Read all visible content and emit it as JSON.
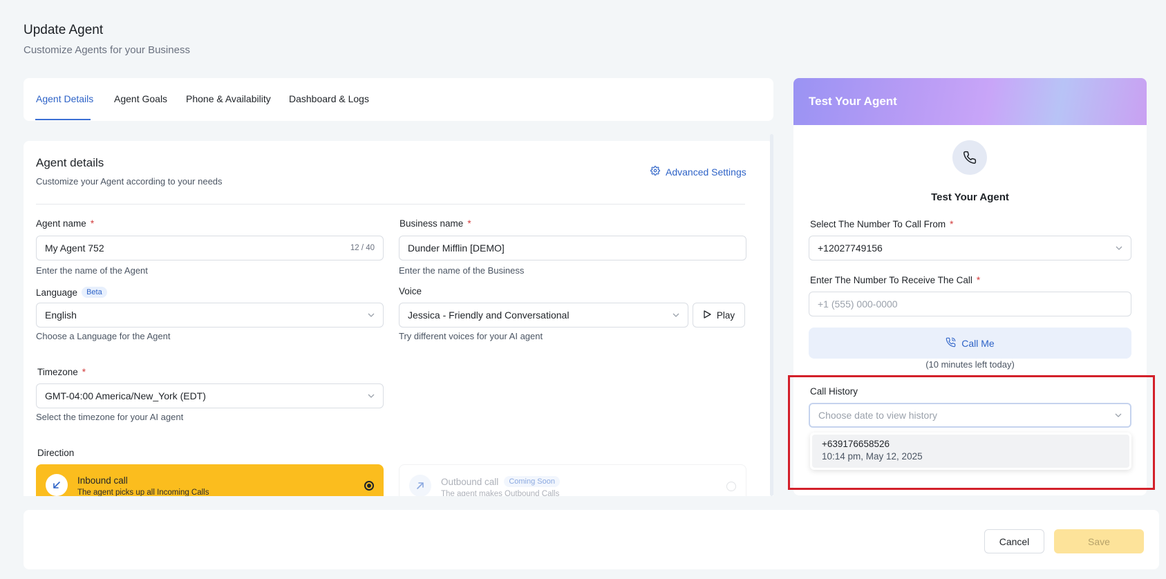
{
  "page": {
    "title": "Update Agent",
    "subtitle": "Customize Agents for your Business"
  },
  "tabs": [
    {
      "label": "Agent Details",
      "active": true
    },
    {
      "label": "Agent Goals",
      "active": false
    },
    {
      "label": "Phone & Availability",
      "active": false
    },
    {
      "label": "Dashboard & Logs",
      "active": false
    }
  ],
  "agent_details": {
    "title": "Agent details",
    "subtitle": "Customize your Agent according to your needs",
    "advanced_settings": "Advanced Settings",
    "agent_name": {
      "label": "Agent name",
      "value": "My Agent 752",
      "counter": "12 / 40",
      "hint": "Enter the name of the Agent"
    },
    "business_name": {
      "label": "Business name",
      "value": "Dunder Mifflin [DEMO]",
      "hint": "Enter the name of the Business"
    },
    "language": {
      "label": "Language",
      "badge": "Beta",
      "value": "English",
      "hint": "Choose a Language for the Agent"
    },
    "voice": {
      "label": "Voice",
      "value": "Jessica - Friendly and Conversational",
      "play": "Play",
      "hint": "Try different voices for your AI agent"
    },
    "timezone": {
      "label": "Timezone",
      "value": "GMT-04:00 America/New_York (EDT)",
      "hint": "Select the timezone for your AI agent"
    },
    "direction": {
      "label": "Direction",
      "inbound": {
        "title": "Inbound call",
        "sub": "The agent picks up all Incoming Calls"
      },
      "outbound": {
        "title": "Outbound call",
        "badge": "Coming Soon",
        "sub": "The agent makes Outbound Calls"
      }
    },
    "required_mark": "*"
  },
  "test_agent": {
    "header": "Test Your Agent",
    "center_title": "Test Your Agent",
    "from_label": "Select The Number To Call From",
    "from_value": "+12027749156",
    "receive_label": "Enter The Number To Receive The Call",
    "receive_placeholder": "+1 (555) 000-0000",
    "call_me": "Call Me",
    "minutes_left": "(10 minutes left today)",
    "history_label": "Call History",
    "history_placeholder": "Choose date to view history",
    "history_items": [
      {
        "number": "+639176658526",
        "date": "10:14 pm, May 12, 2025"
      }
    ]
  },
  "footer": {
    "cancel": "Cancel",
    "save": "Save"
  },
  "colors": {
    "accent": "#2e63c7",
    "inbound_bg": "#fbbd1e",
    "highlight": "#d3202a",
    "save_disabled": "#fde39a"
  },
  "icons": {
    "advanced": "gear-icon",
    "phone": "phone-icon",
    "call_me": "phone-call-icon",
    "play": "play-icon",
    "inbound": "arrow-down-left-icon",
    "outbound": "arrow-up-right-icon",
    "dropdown": "chevron-down-icon"
  }
}
